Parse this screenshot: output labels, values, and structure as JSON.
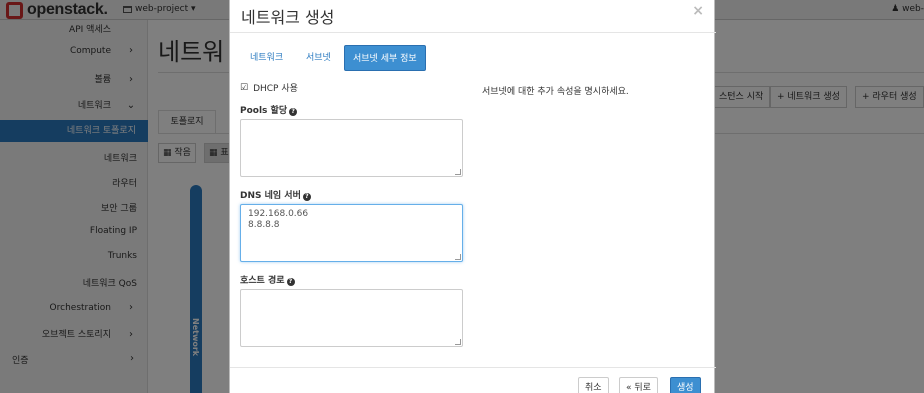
{
  "brand": {
    "logo_text": "openstack."
  },
  "topbar": {
    "project": "web-project ▾",
    "user": "web-"
  },
  "sidebar": {
    "items": [
      {
        "label": "API 액세스",
        "chevron": ""
      },
      {
        "label": "Compute",
        "chevron": "›"
      },
      {
        "label": "볼륨",
        "chevron": "›"
      },
      {
        "label": "네트워크",
        "chevron": "⌄"
      },
      {
        "label": "네트워크 토폴로지",
        "chevron": ""
      },
      {
        "label": "네트워크",
        "chevron": ""
      },
      {
        "label": "라우터",
        "chevron": ""
      },
      {
        "label": "보안 그룹",
        "chevron": ""
      },
      {
        "label": "Floating IP",
        "chevron": ""
      },
      {
        "label": "Trunks",
        "chevron": ""
      },
      {
        "label": "네트워크 QoS",
        "chevron": ""
      },
      {
        "label": "Orchestration",
        "chevron": "›"
      },
      {
        "label": "오브젝트 스토리지",
        "chevron": "›"
      },
      {
        "label": "인증",
        "chevron": "›"
      }
    ]
  },
  "main": {
    "title": "네트워",
    "buttons": {
      "launch_instance": "스턴스 시작",
      "create_network": "+ 네트워크 생성",
      "create_router": "+ 라우터 생성"
    },
    "tab_topology": "토폴로지",
    "view_small": "▦ 작음",
    "view_normal": "▦ 표",
    "external_network": "External-Network"
  },
  "modal": {
    "title": "네트워크 생성",
    "close": "×",
    "tabs": [
      "네트워크",
      "서브넷",
      "서브넷 세부 정보"
    ],
    "dhcp_check": "☑",
    "dhcp_label": "DHCP 사용",
    "pools_label": "Pools 할당",
    "pools_value": "",
    "dns_label": "DNS 네임 서버",
    "dns_value": "192.168.0.66\n8.8.8.8",
    "routes_label": "호스트 경로",
    "routes_value": "",
    "help_glyph": "?",
    "description": "서브넷에 대한 추가 속성을 명시하세요.",
    "footer": {
      "cancel": "취소",
      "back": "« 뒤로",
      "create": "생성"
    }
  }
}
